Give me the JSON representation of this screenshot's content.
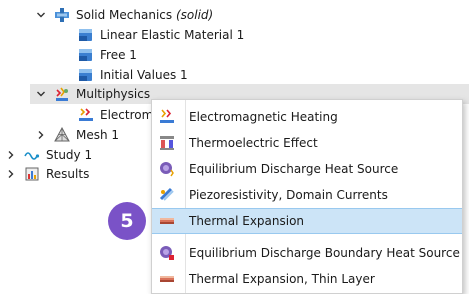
{
  "tree": {
    "solid_mechanics": {
      "label": "Solid Mechanics",
      "suffix": "(solid)"
    },
    "linear_elastic": {
      "label": "Linear Elastic Material 1"
    },
    "free": {
      "label": "Free 1"
    },
    "initial_values": {
      "label": "Initial Values 1"
    },
    "multiphysics": {
      "label": "Multiphysics"
    },
    "electromagnetic_child": {
      "label": "Electrom"
    },
    "mesh": {
      "label": "Mesh 1"
    },
    "study": {
      "label": "Study 1"
    },
    "results": {
      "label": "Results"
    }
  },
  "menu": {
    "items": [
      {
        "label": "Electromagnetic Heating",
        "icon": "electromagnetic-heating-icon"
      },
      {
        "label": "Thermoelectric Effect",
        "icon": "thermoelectric-icon"
      },
      {
        "label": "Equilibrium Discharge Heat Source",
        "icon": "discharge-heat-icon"
      },
      {
        "label": "Piezoresistivity, Domain Currents",
        "icon": "piezoresistivity-icon"
      },
      {
        "label": "Thermal Expansion",
        "icon": "thermal-expansion-icon"
      },
      {
        "label": "Equilibrium Discharge Boundary Heat Source",
        "icon": "discharge-boundary-icon"
      },
      {
        "label": "Thermal Expansion, Thin Layer",
        "icon": "thermal-expansion-thin-icon"
      }
    ],
    "selected_index": 4
  },
  "step_badge": {
    "number": "5"
  },
  "colors": {
    "badge": "#7a52c7",
    "selection": "#cce4f7",
    "row_highlight": "#e5e5e5"
  }
}
